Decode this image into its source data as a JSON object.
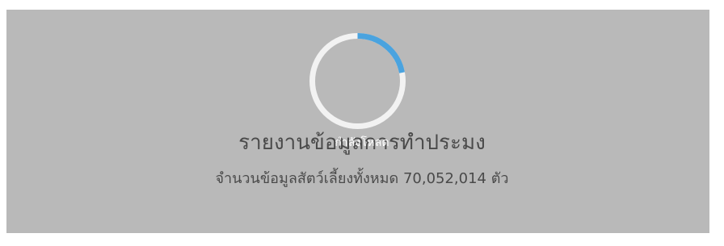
{
  "loader": {
    "label": "กำลังโหลด",
    "progress": 0.22,
    "track_color": "#f2f2f2",
    "accent_color": "#4aa3df"
  },
  "report": {
    "title": "รายงานข้อมูลการทำประมง",
    "subtitle": "จำนวนข้อมูลสัตว์เลี้ยงทั้งหมด 70,052,014 ตัว"
  },
  "colors": {
    "overlay": "#b9b9b9",
    "text": "#4a4a4a"
  }
}
